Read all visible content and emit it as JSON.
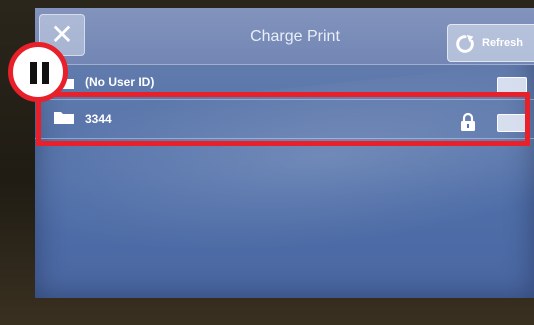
{
  "window": {
    "title": "Charge Print",
    "close_glyph": "✕"
  },
  "toolbar": {
    "refresh_label": "Refresh",
    "refresh_icon": "refresh-icon"
  },
  "list": {
    "items": [
      {
        "label": "(No User ID)",
        "icon": "folder-icon",
        "locked": false
      },
      {
        "label": "3344",
        "icon": "folder-icon",
        "locked": true
      }
    ]
  },
  "annotation": {
    "badge_icon": "pause-icon",
    "highlight_color": "#e8202a"
  },
  "colors": {
    "screen": "#5875ab",
    "titlebar": "#7386b4",
    "text": "#ffffff"
  }
}
